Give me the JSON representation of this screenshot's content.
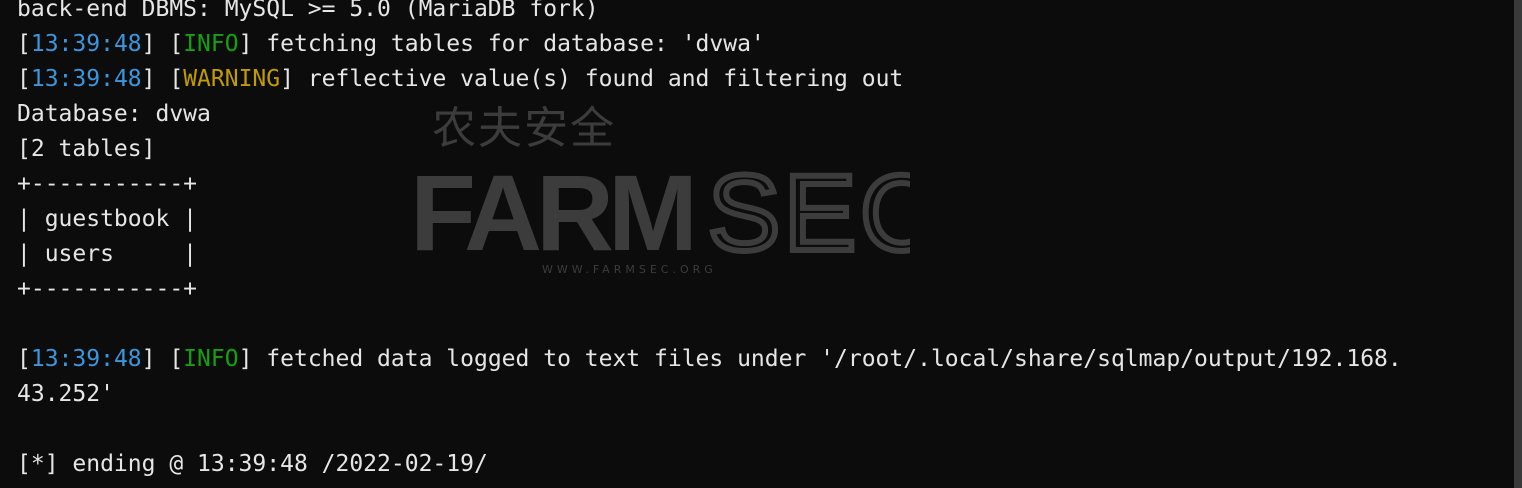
{
  "terminal": {
    "lines": [
      {
        "text": "back-end DBMS: MySQL >= 5.0 (MariaDB fork)"
      },
      {
        "time": "13:39:48",
        "level": "INFO",
        "message": " fetching tables for database: 'dvwa'"
      },
      {
        "time": "13:39:48",
        "level": "WARNING",
        "message": " reflective value(s) found and filtering out"
      },
      {
        "text": "Database: dvwa"
      },
      {
        "text": "[2 tables]"
      },
      {
        "text": "+-----------+"
      },
      {
        "text": "| guestbook |"
      },
      {
        "text": "| users     |"
      },
      {
        "text": "+-----------+"
      },
      {
        "text": ""
      },
      {
        "time": "13:39:48",
        "level": "INFO",
        "message": " fetched data logged to text files under '/root/.local/share/sqlmap/output/192.168."
      },
      {
        "text": "43.252'"
      },
      {
        "text": ""
      },
      {
        "text": "[*] ending @ 13:39:48 /2022-02-19/"
      }
    ]
  },
  "watermark": {
    "chinese": "农夫安全",
    "brand_bold": "FARM",
    "brand_outline": "SEC",
    "url": "WWW.FARMSEC.ORG"
  },
  "colors": {
    "background": "#0c0c0c",
    "text": "#e6e6e6",
    "timestamp": "#3a96dd",
    "info": "#13a10e",
    "warning": "#c19c00",
    "watermark": "#3c3c3c"
  }
}
